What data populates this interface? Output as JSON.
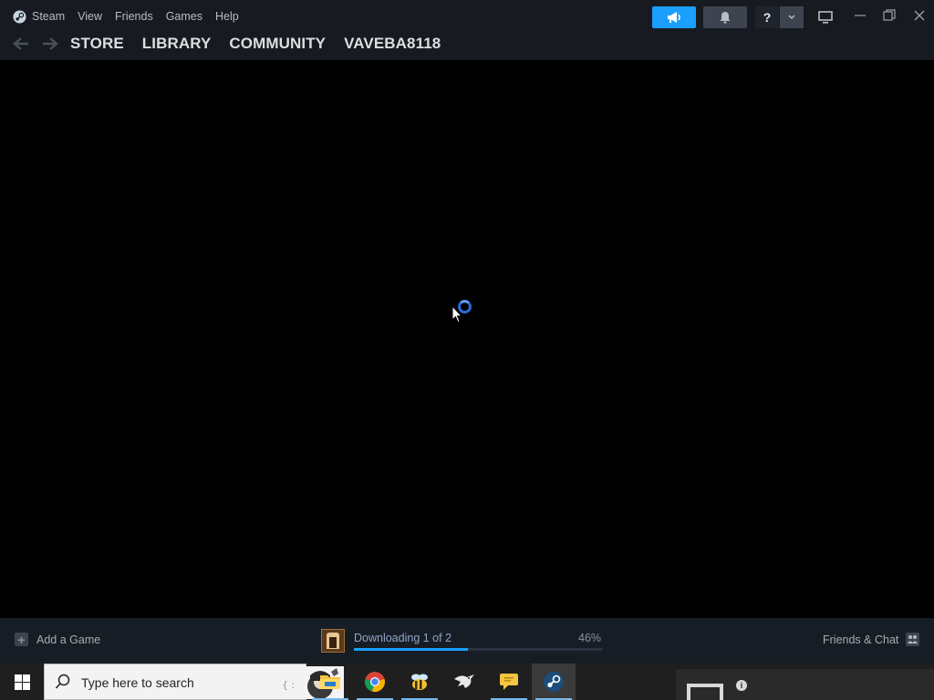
{
  "menu": {
    "app_name": "Steam",
    "items": [
      "View",
      "Friends",
      "Games",
      "Help"
    ],
    "help_label": "?"
  },
  "nav": {
    "links": [
      "STORE",
      "LIBRARY",
      "COMMUNITY",
      "VAVEBA8118"
    ]
  },
  "footer": {
    "add_game_label": "Add a Game",
    "add_game_icon": "plus-icon",
    "download_status": "Downloading 1 of 2",
    "download_percent_text": "46%",
    "download_progress": 0.46,
    "friends_label": "Friends & Chat"
  },
  "taskbar": {
    "search_placeholder": "Type here to search",
    "apps": [
      "file-explorer-icon",
      "chrome-icon",
      "bee-app-icon",
      "eagle-app-icon",
      "chat-bubble-icon",
      "steam-icon"
    ]
  },
  "colors": {
    "accent": "#1a9fff",
    "titlebar": "#171a21",
    "footer": "#171d25",
    "content": "#000000"
  }
}
